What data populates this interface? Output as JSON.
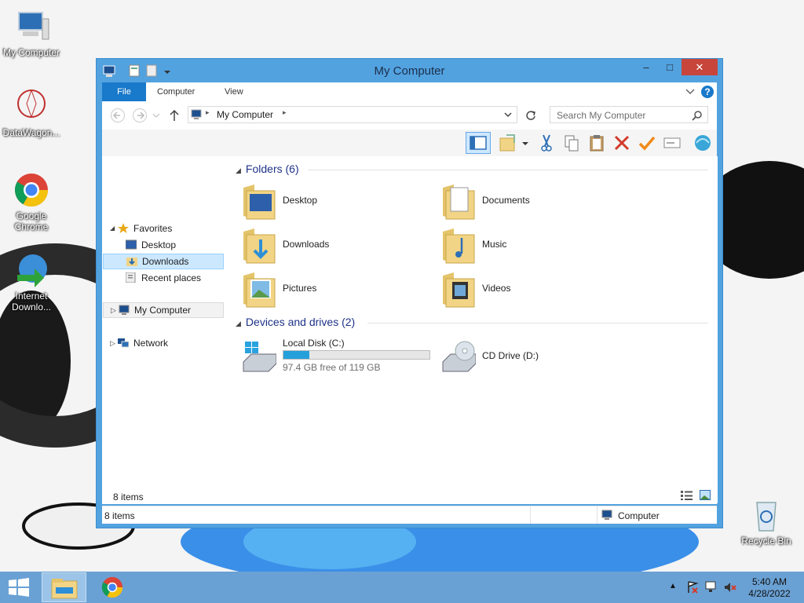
{
  "desktop": {
    "icons": [
      {
        "label": "My Computer"
      },
      {
        "label": "DataWagon..."
      },
      {
        "label": "Google Chrome"
      },
      {
        "label": "Internet Downlo..."
      },
      {
        "label": "Recycle Bin"
      }
    ]
  },
  "window": {
    "title": "My Computer",
    "controls": {
      "minimize": "–",
      "maximize": "□",
      "close": "✕"
    },
    "ribbon_tabs": [
      "File",
      "Computer",
      "View"
    ],
    "address": {
      "location": "My Computer"
    },
    "search": {
      "placeholder": "Search My Computer"
    },
    "nav": {
      "favorites": "Favorites",
      "items": [
        "Desktop",
        "Downloads",
        "Recent places"
      ],
      "my_computer": "My Computer",
      "network": "Network"
    },
    "groups": {
      "folders": "Folders (6)",
      "devices": "Devices and drives (2)"
    },
    "folders": [
      "Desktop",
      "Documents",
      "Downloads",
      "Music",
      "Pictures",
      "Videos"
    ],
    "drives": {
      "c": {
        "name": "Local Disk (C:)",
        "free": "97.4 GB free of 119 GB",
        "used_fraction": 0.18
      },
      "d": {
        "name": "CD Drive (D:)"
      }
    },
    "info": {
      "count": "8 items"
    },
    "status": {
      "count": "8 items",
      "location": "Computer"
    }
  },
  "taskbar": {
    "time": "5:40 AM",
    "date": "4/28/2022"
  },
  "colors": {
    "accent": "#1979ca",
    "titlebar": "#52a2e0",
    "close": "#c7453b",
    "taskbar": "#6aa1d4",
    "progress": "#26a0da"
  }
}
